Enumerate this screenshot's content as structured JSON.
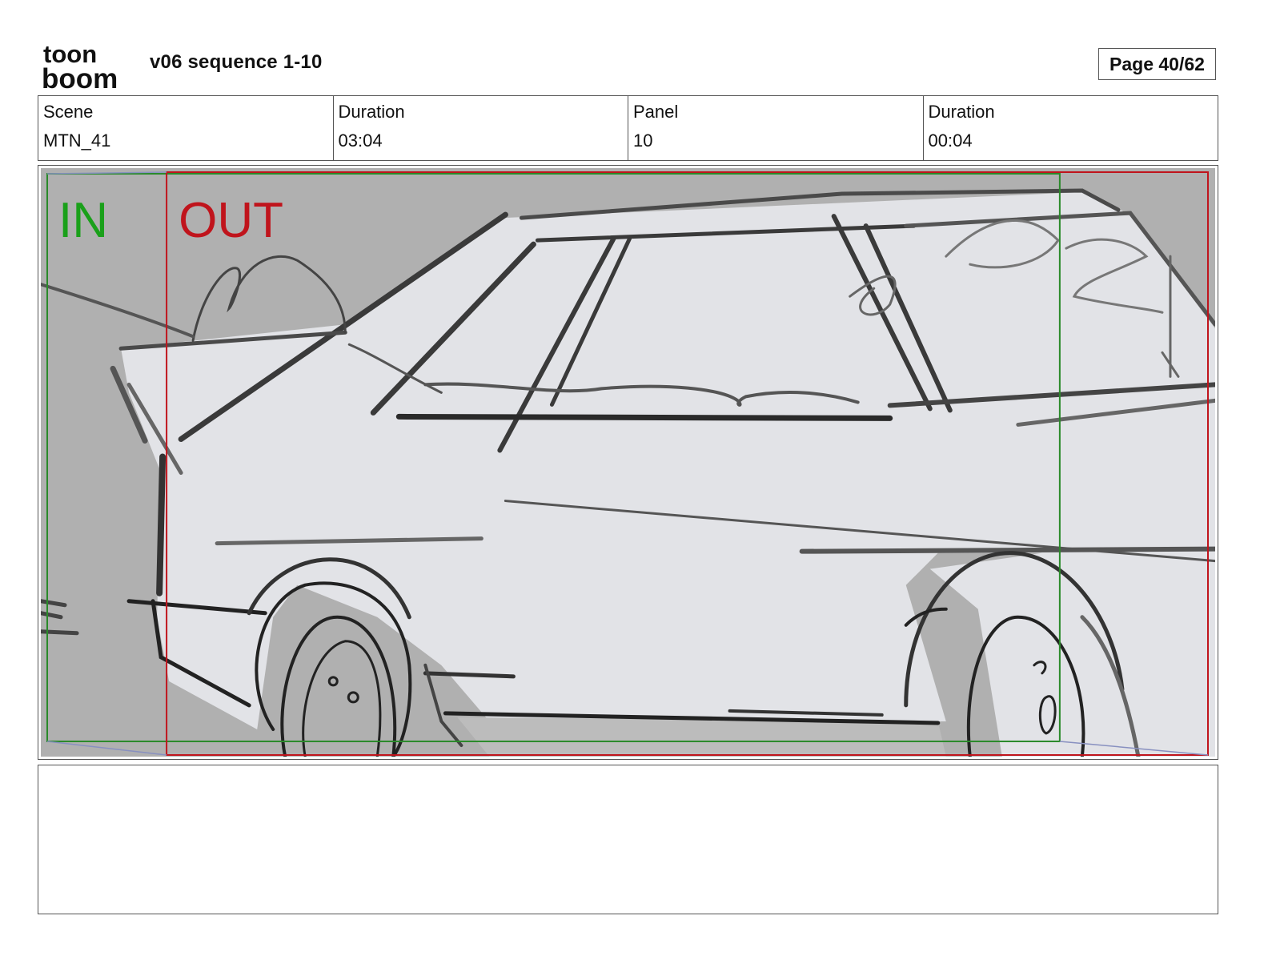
{
  "header": {
    "logo_line1": "toon",
    "logo_line2": "boom",
    "title": "v06 sequence 1-10",
    "page_label": "Page 40/62"
  },
  "info": {
    "scene_label": "Scene",
    "scene_value": "MTN_41",
    "scene_duration_label": "Duration",
    "scene_duration_value": "03:04",
    "panel_label": "Panel",
    "panel_value": "10",
    "panel_duration_label": "Duration",
    "panel_duration_value": "00:04"
  },
  "panel": {
    "in_label": "IN",
    "out_label": "OUT",
    "in_color": "#1aa01a",
    "out_color": "#c0141c"
  },
  "notes": {
    "text": ""
  }
}
